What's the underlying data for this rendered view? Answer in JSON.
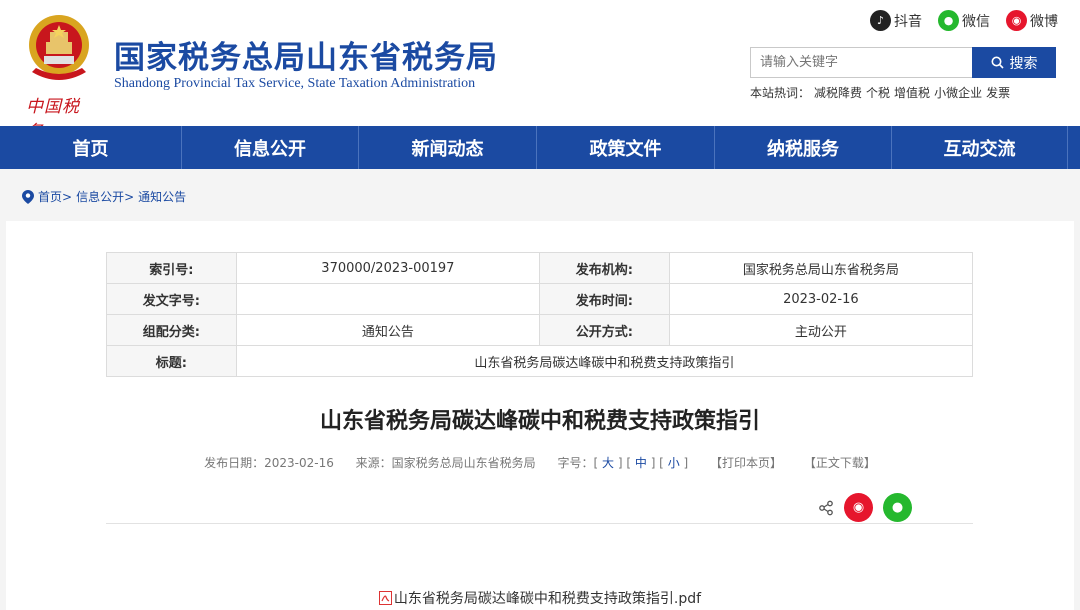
{
  "header": {
    "title_cn": "国家税务总局山东省税务局",
    "title_en": "Shandong Provincial Tax Service, State Taxation Administration",
    "brand_script": "中国税务",
    "social": [
      {
        "label": "抖音",
        "icon": "douyin-icon"
      },
      {
        "label": "微信",
        "icon": "wechat-icon"
      },
      {
        "label": "微博",
        "icon": "weibo-icon"
      }
    ],
    "search": {
      "placeholder": "请输入关键字",
      "button": "搜索"
    },
    "hot": {
      "label": "本站热词：",
      "keywords": [
        "减税降费",
        "个税",
        "增值税",
        "小微企业",
        "发票"
      ]
    }
  },
  "nav": [
    "首页",
    "信息公开",
    "新闻动态",
    "政策文件",
    "纳税服务",
    "互动交流"
  ],
  "breadcrumb": [
    "首页>",
    "信息公开>",
    "通知公告"
  ],
  "meta": {
    "rows": [
      {
        "l1": "索引号:",
        "v1": "370000/2023-00197",
        "l2": "发布机构:",
        "v2": "国家税务总局山东省税务局"
      },
      {
        "l1": "发文字号:",
        "v1": "",
        "l2": "发布时间:",
        "v2": "2023-02-16"
      },
      {
        "l1": "组配分类:",
        "v1": "通知公告",
        "l2": "公开方式:",
        "v2": "主动公开"
      }
    ],
    "title_label": "标题:",
    "title_value": "山东省税务局碳达峰碳中和税费支持政策指引"
  },
  "doc": {
    "title": "山东省税务局碳达峰碳中和税费支持政策指引",
    "date": "发布日期：2023-02-16",
    "source": "来源：国家税务总局山东省税务局",
    "font_label": "字号：",
    "font_sizes": [
      "大",
      "中",
      "小"
    ],
    "print": "【打印本页】",
    "download": "【正文下载】",
    "attachment": "山东省税务局碳达峰碳中和税费支持政策指引.pdf"
  },
  "colors": {
    "brand_blue": "#1b4aa2",
    "weibo_red": "#e6162d",
    "wechat_green": "#25b82e"
  }
}
